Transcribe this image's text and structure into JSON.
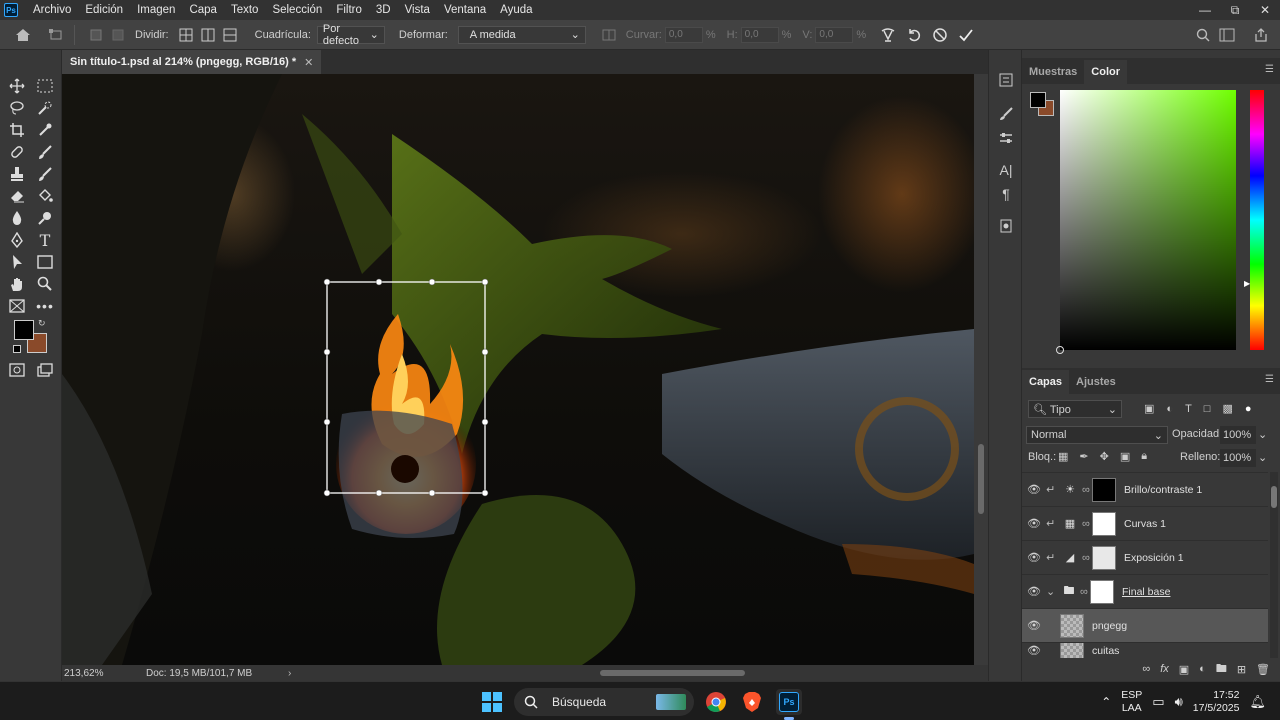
{
  "menubar": {
    "logo": "Ps",
    "items": [
      "Archivo",
      "Edición",
      "Imagen",
      "Capa",
      "Texto",
      "Selección",
      "Filtro",
      "3D",
      "Vista",
      "Ventana",
      "Ayuda"
    ]
  },
  "options": {
    "dividir_label": "Dividir:",
    "cuadricula_label": "Cuadrícula:",
    "cuadricula_value": "Por defecto",
    "deformar_label": "Deformar:",
    "deformar_value": "A medida",
    "curvar_label": "Curvar:",
    "curvar_value": "0,0",
    "h_label": "H:",
    "h_value": "0,0",
    "v_label": "V:",
    "v_value": "0,0",
    "percent": "%"
  },
  "document": {
    "tab_title": "Sin título-1.psd al 214% (pngegg, RGB/16) *",
    "zoom": "213,62%",
    "doc_info": "Doc: 19,5 MB/101,7 MB"
  },
  "color_panel": {
    "tabs": [
      "Muestras",
      "Color"
    ],
    "active_tab": "Color",
    "foreground": "#000000",
    "background": "#8a4a2a"
  },
  "layers_panel": {
    "tabs": [
      "Capas",
      "Ajustes"
    ],
    "active_tab": "Capas",
    "filter": "Tipo",
    "blend_mode": "Normal",
    "opacity_label": "Opacidad:",
    "opacity_value": "100%",
    "lock_label": "Bloq.:",
    "fill_label": "Relleno:",
    "fill_value": "100%",
    "layers": [
      {
        "name": "Brillo/contraste 1",
        "type": "adjustment"
      },
      {
        "name": "Curvas 1",
        "type": "adjustment"
      },
      {
        "name": "Exposición 1",
        "type": "adjustment"
      },
      {
        "name": "Final base",
        "type": "group"
      },
      {
        "name": "pngegg",
        "type": "pixel",
        "selected": true
      },
      {
        "name": "cuitas",
        "type": "pixel"
      }
    ]
  },
  "taskbar": {
    "search_label": "Búsqueda",
    "lang_top": "ESP",
    "lang_bottom": "LAA",
    "time": "17:52",
    "date": "17/5/2025"
  }
}
